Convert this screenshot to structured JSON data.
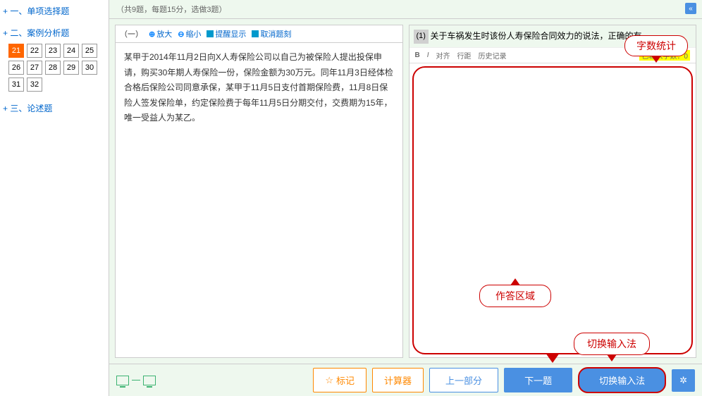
{
  "sidebar": {
    "sections": [
      {
        "title": "+ 一、单项选择题"
      },
      {
        "title": "+ 二、案例分析题"
      },
      {
        "title": "+ 三、论述题"
      }
    ],
    "items": [
      "21",
      "22",
      "23",
      "24",
      "25",
      "26",
      "27",
      "28",
      "29",
      "30",
      "31",
      "32"
    ]
  },
  "info_bar": "（共9题，每题15分，选做3题）",
  "toolbar": {
    "group_label": "（一）",
    "zoom_in": "放大",
    "zoom_out": "缩小",
    "remind": "提醒显示",
    "cancel": "取消题刻"
  },
  "question_text": "某甲于2014年11月2日向X人寿保险公司以自己为被保险人提出投保申请，购买30年期人寿保险一份，保险金额为30万元。同年11月3日经体检合格后保险公司同意承保，某甲于11月5日支付首期保险费，11月8日保险人签发保险单，约定保险费于每年11月5日分期交付，交费期为15年，唯一受益人为某乙。",
  "sub_q": {
    "num": "(1)",
    "text": "关于车祸发生时该份人寿保险合同效力的说法，正确的有。"
  },
  "editor_toolbar": {
    "bold": "B",
    "italic": "I",
    "align": "对齐",
    "line": "行距",
    "history": "历史记录",
    "wordcount_label": "已输入字数：0"
  },
  "callouts": {
    "wordcount": "字数统计",
    "answer_area": "作答区域",
    "ime": "切换输入法"
  },
  "footer": {
    "mark": "标记",
    "calc": "计算器",
    "prev": "上一部分",
    "next": "下一题",
    "ime": "切换输入法",
    "gear": "✲"
  }
}
